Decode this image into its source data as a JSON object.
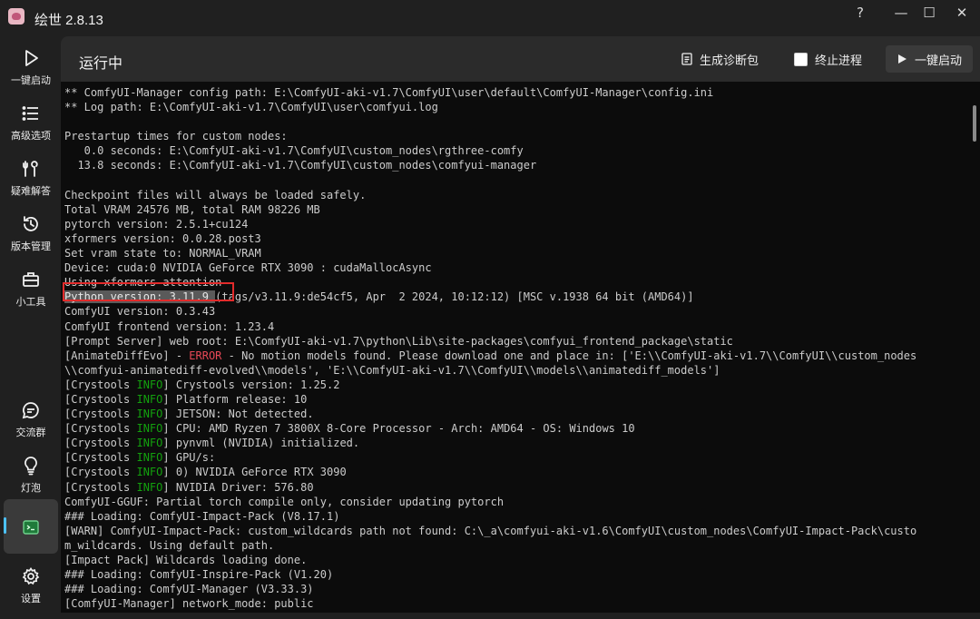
{
  "window": {
    "title": "绘世 2.8.13",
    "help_icon": "?",
    "minimize_icon": "—",
    "maximize_icon": "☐",
    "close_icon": "✕"
  },
  "sidebar": {
    "items": [
      {
        "label": "一键启动",
        "icon": "play-icon"
      },
      {
        "label": "高级选项",
        "icon": "list-icon"
      },
      {
        "label": "疑难解答",
        "icon": "tools-icon"
      },
      {
        "label": "版本管理",
        "icon": "history-icon"
      },
      {
        "label": "小工具",
        "icon": "toolbox-icon"
      },
      {
        "label": "交流群",
        "icon": "chat-icon"
      },
      {
        "label": "灯泡",
        "icon": "lightbulb-icon"
      },
      {
        "label": "",
        "icon": "console-icon"
      },
      {
        "label": "设置",
        "icon": "gear-icon"
      }
    ],
    "accent_color": "#4cc2ff"
  },
  "header": {
    "title": "运行中",
    "diagnostics_label": "生成诊断包",
    "terminate_label": "终止进程",
    "start_label": "一键启动"
  },
  "console": {
    "lines": [
      [
        {
          "t": "** ComfyUI-Manager config path: E:\\ComfyUI-aki-v1.7\\ComfyUI\\user\\default\\ComfyUI-Manager\\config.ini"
        }
      ],
      [
        {
          "t": "** Log path: E:\\ComfyUI-aki-v1.7\\ComfyUI\\user\\comfyui.log"
        }
      ],
      [
        {
          "t": ""
        }
      ],
      [
        {
          "t": "Prestartup times for custom nodes:"
        }
      ],
      [
        {
          "t": "   0.0 seconds: E:\\ComfyUI-aki-v1.7\\ComfyUI\\custom_nodes\\rgthree-comfy"
        }
      ],
      [
        {
          "t": "  13.8 seconds: E:\\ComfyUI-aki-v1.7\\ComfyUI\\custom_nodes\\comfyui-manager"
        }
      ],
      [
        {
          "t": ""
        }
      ],
      [
        {
          "t": "Checkpoint files will always be loaded safely."
        }
      ],
      [
        {
          "t": "Total VRAM 24576 MB, total RAM 98226 MB"
        }
      ],
      [
        {
          "t": "pytorch version: 2.5.1+cu124"
        }
      ],
      [
        {
          "t": "xformers version: 0.0.28.post3"
        }
      ],
      [
        {
          "t": "Set vram state to: NORMAL_VRAM"
        }
      ],
      [
        {
          "t": "Device: cuda:0 NVIDIA GeForce RTX 3090 : cudaMallocAsync"
        }
      ],
      [
        {
          "t": "Using xformers attention"
        }
      ],
      [
        {
          "t": "Python version: 3.11.9 ",
          "c": "sel"
        },
        {
          "t": "(tags/v3.11.9:de54cf5, Apr  2 2024, 10:12:12) [MSC v.1938 64 bit (AMD64)]"
        }
      ],
      [
        {
          "t": "ComfyUI version: 0.3.43"
        }
      ],
      [
        {
          "t": "ComfyUI frontend version: 1.23.4"
        }
      ],
      [
        {
          "t": "[Prompt Server] web root: E:\\ComfyUI-aki-v1.7\\python\\Lib\\site-packages\\comfyui_frontend_package\\static"
        }
      ],
      [
        {
          "t": "[AnimateDiffEvo] - "
        },
        {
          "t": "ERROR",
          "c": "err"
        },
        {
          "t": " - No motion models found. Please download one and place in: ['E:\\\\ComfyUI-aki-v1.7\\\\ComfyUI\\\\custom_nodes"
        }
      ],
      [
        {
          "t": "\\\\comfyui-animatediff-evolved\\\\models', 'E:\\\\ComfyUI-aki-v1.7\\\\ComfyUI\\\\models\\\\animatediff_models']"
        }
      ],
      [
        {
          "t": "[Crystools "
        },
        {
          "t": "INFO",
          "c": "info"
        },
        {
          "t": "] Crystools version: 1.25.2"
        }
      ],
      [
        {
          "t": "[Crystools "
        },
        {
          "t": "INFO",
          "c": "info"
        },
        {
          "t": "] Platform release: 10"
        }
      ],
      [
        {
          "t": "[Crystools "
        },
        {
          "t": "INFO",
          "c": "info"
        },
        {
          "t": "] JETSON: Not detected."
        }
      ],
      [
        {
          "t": "[Crystools "
        },
        {
          "t": "INFO",
          "c": "info"
        },
        {
          "t": "] CPU: AMD Ryzen 7 3800X 8-Core Processor - Arch: AMD64 - OS: Windows 10"
        }
      ],
      [
        {
          "t": "[Crystools "
        },
        {
          "t": "INFO",
          "c": "info"
        },
        {
          "t": "] pynvml (NVIDIA) initialized."
        }
      ],
      [
        {
          "t": "[Crystools "
        },
        {
          "t": "INFO",
          "c": "info"
        },
        {
          "t": "] GPU/s:"
        }
      ],
      [
        {
          "t": "[Crystools "
        },
        {
          "t": "INFO",
          "c": "info"
        },
        {
          "t": "] 0) NVIDIA GeForce RTX 3090"
        }
      ],
      [
        {
          "t": "[Crystools "
        },
        {
          "t": "INFO",
          "c": "info"
        },
        {
          "t": "] NVIDIA Driver: 576.80"
        }
      ],
      [
        {
          "t": "ComfyUI-GGUF: Partial torch compile only, consider updating pytorch"
        }
      ],
      [
        {
          "t": "### Loading: ComfyUI-Impact-Pack (V8.17.1)"
        }
      ],
      [
        {
          "t": "[WARN] ComfyUI-Impact-Pack: custom_wildcards path not found: C:\\_a\\comfyui-aki-v1.6\\ComfyUI\\custom_nodes\\ComfyUI-Impact-Pack\\custo"
        }
      ],
      [
        {
          "t": "m_wildcards. Using default path."
        }
      ],
      [
        {
          "t": "[Impact Pack] Wildcards loading done."
        }
      ],
      [
        {
          "t": "### Loading: ComfyUI-Inspire-Pack (V1.20)"
        }
      ],
      [
        {
          "t": "### Loading: ComfyUI-Manager (V3.33.3)"
        }
      ],
      [
        {
          "t": "[ComfyUI-Manager] network_mode: public"
        }
      ]
    ]
  }
}
